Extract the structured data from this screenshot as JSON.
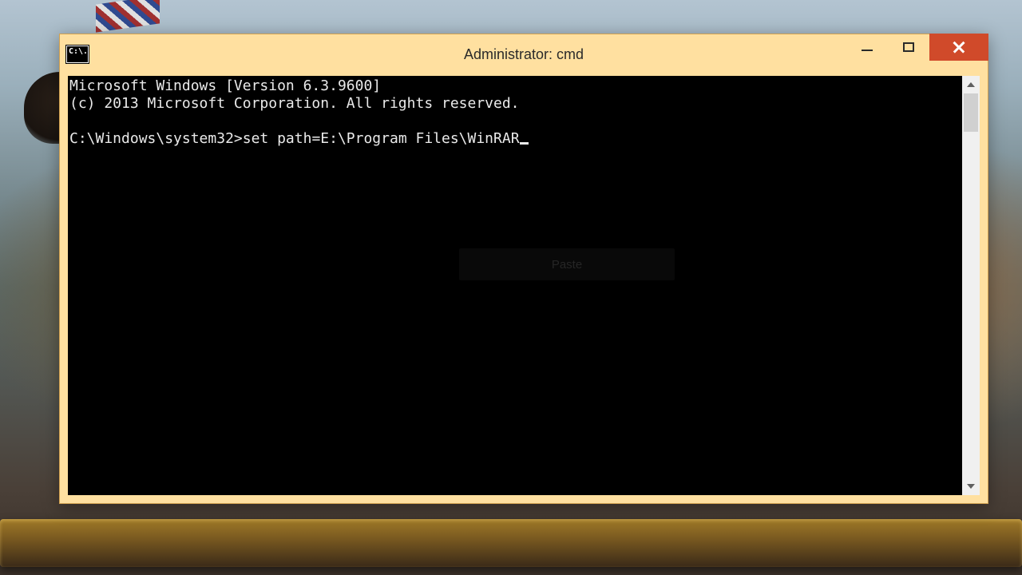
{
  "window": {
    "title": "Administrator: cmd",
    "icon_label": "C:\\."
  },
  "console": {
    "banner_line1": "Microsoft Windows [Version 6.3.9600]",
    "banner_line2": "(c) 2013 Microsoft Corporation. All rights reserved.",
    "prompt": "C:\\Windows\\system32>",
    "command": "set path=E:\\Program Files\\WinRAR"
  },
  "ghost_tooltip": "Paste"
}
